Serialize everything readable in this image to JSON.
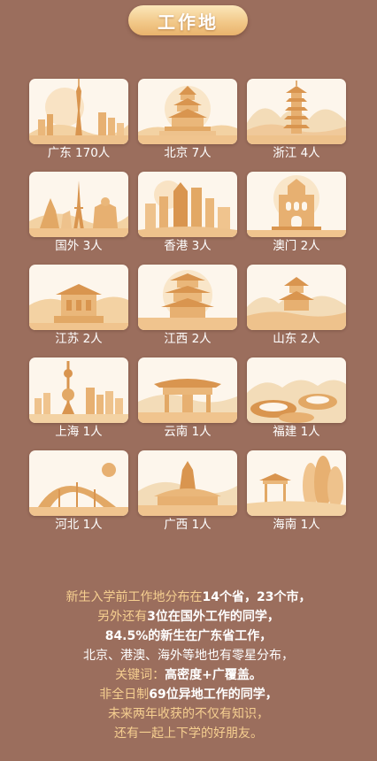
{
  "header": {
    "title": "工作地"
  },
  "locations": [
    {
      "label": "广东 170人",
      "icon": "canton-tower-icon"
    },
    {
      "label": "北京 7人",
      "icon": "temple-of-heaven-icon"
    },
    {
      "label": "浙江 4人",
      "icon": "leifeng-pagoda-icon"
    },
    {
      "label": "国外 3人",
      "icon": "eiffel-tower-icon"
    },
    {
      "label": "香港 3人",
      "icon": "hong-kong-skyline-icon"
    },
    {
      "label": "澳门 2人",
      "icon": "ruins-of-st-paul-icon"
    },
    {
      "label": "江苏 2人",
      "icon": "sun-yat-sen-mausoleum-icon"
    },
    {
      "label": "江西 2人",
      "icon": "tengwang-pavilion-icon"
    },
    {
      "label": "山东 2人",
      "icon": "shandong-pavilion-icon"
    },
    {
      "label": "上海 1人",
      "icon": "oriental-pearl-tower-icon"
    },
    {
      "label": "云南 1人",
      "icon": "yunnan-gate-icon"
    },
    {
      "label": "福建 1人",
      "icon": "tulou-icon"
    },
    {
      "label": "河北 1人",
      "icon": "stadium-icon"
    },
    {
      "label": "广西 1人",
      "icon": "guangxi-hall-icon"
    },
    {
      "label": "海南 1人",
      "icon": "hainan-pavilion-icon"
    }
  ],
  "summary": {
    "l1a": "新生入学前工作地分布在",
    "l1b": "14个省，23个市，",
    "l2a": "另外还有",
    "l2b": "3位在国外工作的同学，",
    "l3a": "84.5%的新生在广东省工作，",
    "l4a": "北京、港澳、海外等地也有零星分布，",
    "l5a": "关键词：",
    "l5b": "高密度+广覆盖。",
    "l6a": "非全日制",
    "l6b": "69位异地工作的同学，",
    "l7a": "未来两年收获的不仅有知识，",
    "l8a": "还有一起上下学的好朋友。"
  },
  "colors": {
    "background": "#9b6e5d",
    "card": "#fdf6ec",
    "title_pill": "#f2c98a",
    "highlight": "#f6cf90",
    "illustration": "#e6b070"
  }
}
